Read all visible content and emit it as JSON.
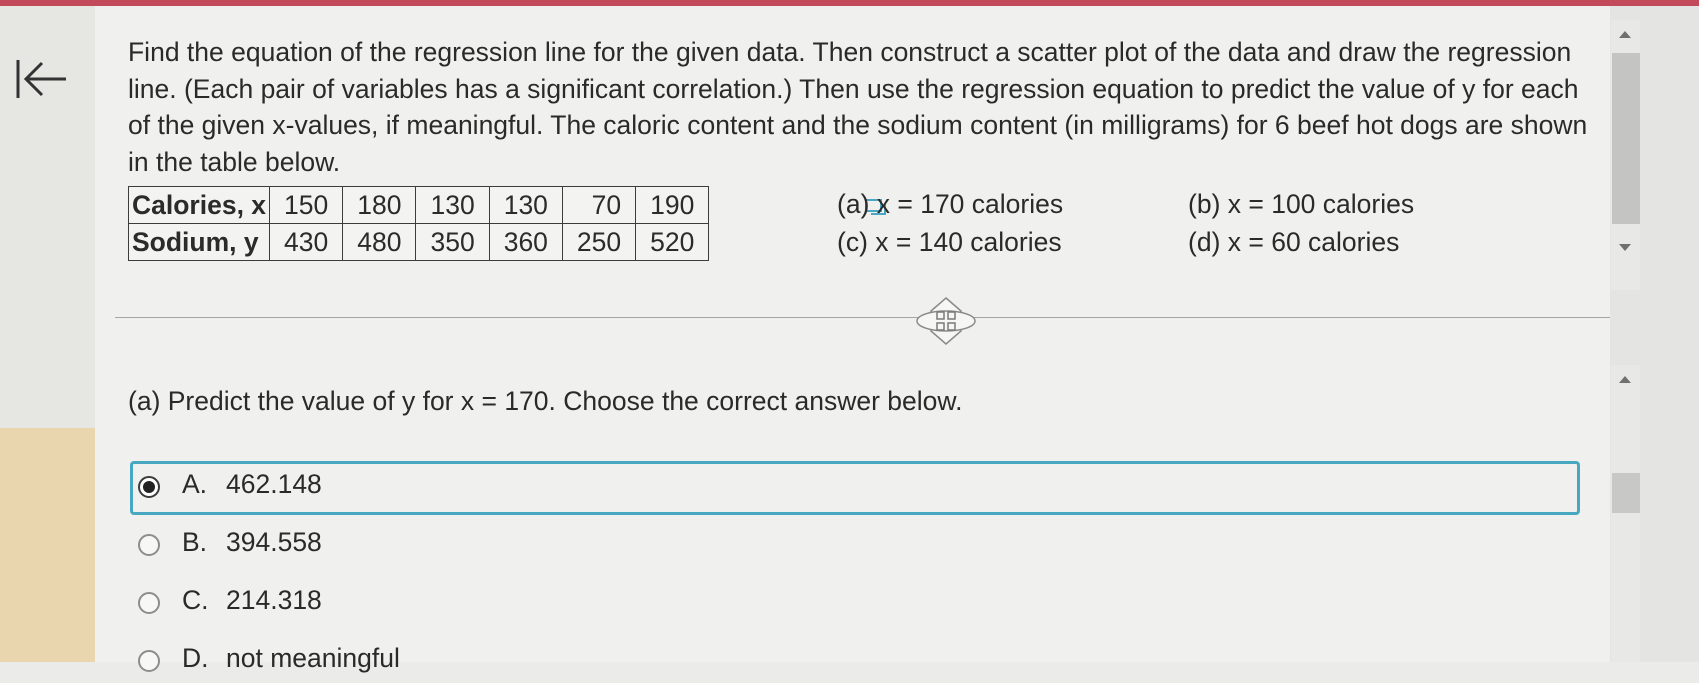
{
  "problem": {
    "text": "Find the equation of the regression line for the given data. Then construct a scatter plot of the data and draw the regression line. (Each pair of variables has a significant correlation.) Then use the regression equation to predict the value of y for each of the given x-values, if meaningful. The caloric content and the sodium content (in milligrams) for 6 beef hot dogs are shown in the table below."
  },
  "table": {
    "rows": [
      {
        "label": "Calories, x",
        "values": [
          "150",
          "180",
          "130",
          "130",
          "70",
          "190"
        ]
      },
      {
        "label": "Sodium, y",
        "values": [
          "430",
          "480",
          "350",
          "360",
          "250",
          "520"
        ]
      }
    ]
  },
  "x_values": {
    "a": "(a) x = 170 calories",
    "b": "(b) x = 100 calories",
    "c": "(c) x = 140 calories",
    "d": "(d) x = 60 calories"
  },
  "question": "(a) Predict the value of y for x = 170. Choose the correct answer below.",
  "options": [
    {
      "letter": "A.",
      "text": "462.148",
      "selected": true
    },
    {
      "letter": "B.",
      "text": "394.558",
      "selected": false
    },
    {
      "letter": "C.",
      "text": "214.318",
      "selected": false
    },
    {
      "letter": "D.",
      "text": "not meaningful",
      "selected": false
    }
  ],
  "icons": {
    "back": "back-to-start-icon",
    "popout": "popout-icon",
    "resize": "move-handle-icon"
  },
  "colors": {
    "accent_top": "#c24a5a",
    "selected_border": "#48a8c2",
    "left_highlight": "#e9d6ae"
  }
}
